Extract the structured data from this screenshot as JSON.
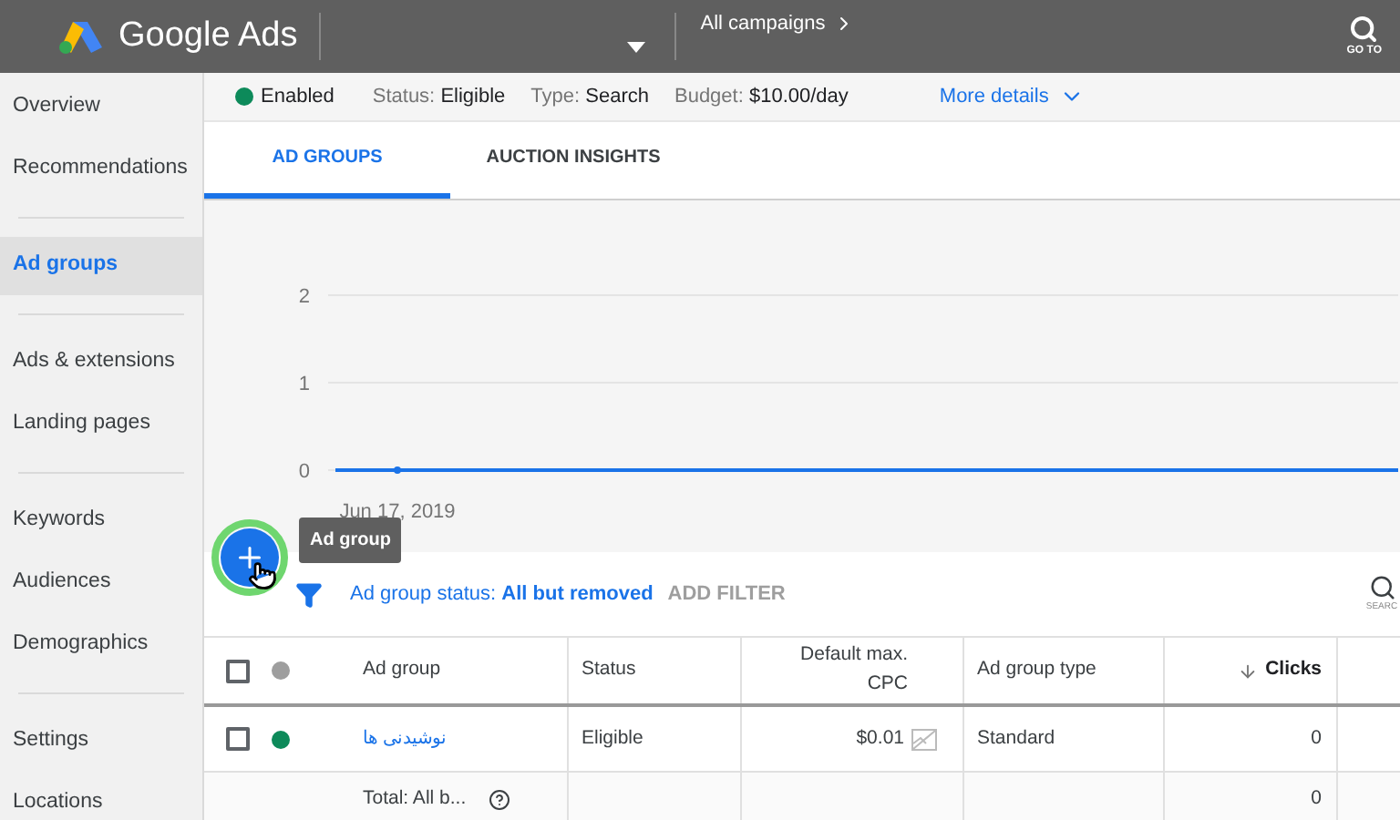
{
  "header": {
    "product": "Google Ads",
    "breadcrumb": "All campaigns",
    "goto_label": "GO TO"
  },
  "sidebar": {
    "groups": [
      [
        {
          "label": "Overview",
          "selected": false
        },
        {
          "label": "Recommendations",
          "selected": false
        }
      ],
      [
        {
          "label": "Ad groups",
          "selected": true
        }
      ],
      [
        {
          "label": "Ads & extensions",
          "selected": false
        },
        {
          "label": "Landing pages",
          "selected": false
        }
      ],
      [
        {
          "label": "Keywords",
          "selected": false
        },
        {
          "label": "Audiences",
          "selected": false
        },
        {
          "label": "Demographics",
          "selected": false
        }
      ],
      [
        {
          "label": "Settings",
          "selected": false
        },
        {
          "label": "Locations",
          "selected": false
        }
      ]
    ]
  },
  "summary": {
    "status": {
      "label": "Enabled",
      "color": "#0d8a5a"
    },
    "items": [
      {
        "key": "Status:",
        "value": "Eligible"
      },
      {
        "key": "Type:",
        "value": "Search"
      },
      {
        "key": "Budget:",
        "value": "$10.00/day"
      }
    ],
    "more": "More details"
  },
  "tabs": [
    {
      "label": "AD GROUPS",
      "selected": true
    },
    {
      "label": "AUCTION INSIGHTS",
      "selected": false
    }
  ],
  "chart": {
    "chart_data": {
      "type": "line",
      "x": [
        "Jun 17, 2019"
      ],
      "series": [
        {
          "color": "#1a73e8",
          "marker": true,
          "values": [
            0
          ]
        }
      ],
      "yticks": [
        0,
        1,
        2
      ],
      "ylim": [
        0,
        2
      ]
    }
  },
  "fab": {
    "tooltip": "Ad group"
  },
  "filter": {
    "label": "Ad group status: **All but removed**",
    "add": "ADD FILTER",
    "search_label": "SEARC"
  },
  "table": {
    "header_checked": false,
    "columns": [
      "Ad group",
      "Status",
      "Default max. CPC",
      "Ad group type",
      "Clicks"
    ],
    "rows": [
      {
        "checked": false,
        "color": "#0d8a5a",
        "cells": [
          "نوشیدنی ها",
          "Eligible",
          "$0.01",
          "Standard",
          "0"
        ]
      }
    ],
    "total": {
      "label": "Total: All b...",
      "clicks": "0"
    }
  }
}
